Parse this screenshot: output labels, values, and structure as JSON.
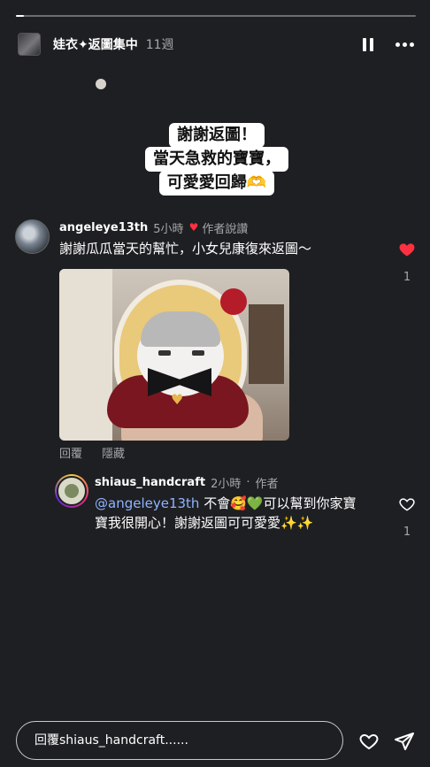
{
  "progress": {
    "fraction": 0.02
  },
  "story": {
    "username": "娃衣✦返圖集中",
    "time": "11週",
    "pause_icon": "pause-icon",
    "more_icon": "more-icon"
  },
  "sticker": {
    "lines": [
      "謝謝返圖！",
      "當天急救的寶寶，",
      "可愛愛回歸🫶"
    ]
  },
  "comments": [
    {
      "username": "angeleye13th",
      "time": "5小時",
      "liked_by_author_label": "作者說讚",
      "text": "謝謝瓜瓜當天的幫忙，小女兒康復來返圖～",
      "likes": "1",
      "liked": true,
      "actions": {
        "reply": "回覆",
        "hide": "隱藏"
      },
      "heart_color": "#ff3040"
    },
    {
      "username": "shiaus_handcraft",
      "time": "2小時",
      "author_label": "作者",
      "mention": "@angeleye13th",
      "text": " 不會🥰💚可以幫到你家寶寶我很開心！謝謝返圖可可愛愛✨✨",
      "likes": "1",
      "liked": false
    }
  ],
  "reply_bar": {
    "placeholder": "回覆shiaus_handcraft......"
  },
  "icons": {
    "like": "heart-icon",
    "send": "send-icon"
  },
  "colors": {
    "background": "#1e1f22",
    "mention": "#8fb4ff",
    "like_red": "#ff3040"
  }
}
